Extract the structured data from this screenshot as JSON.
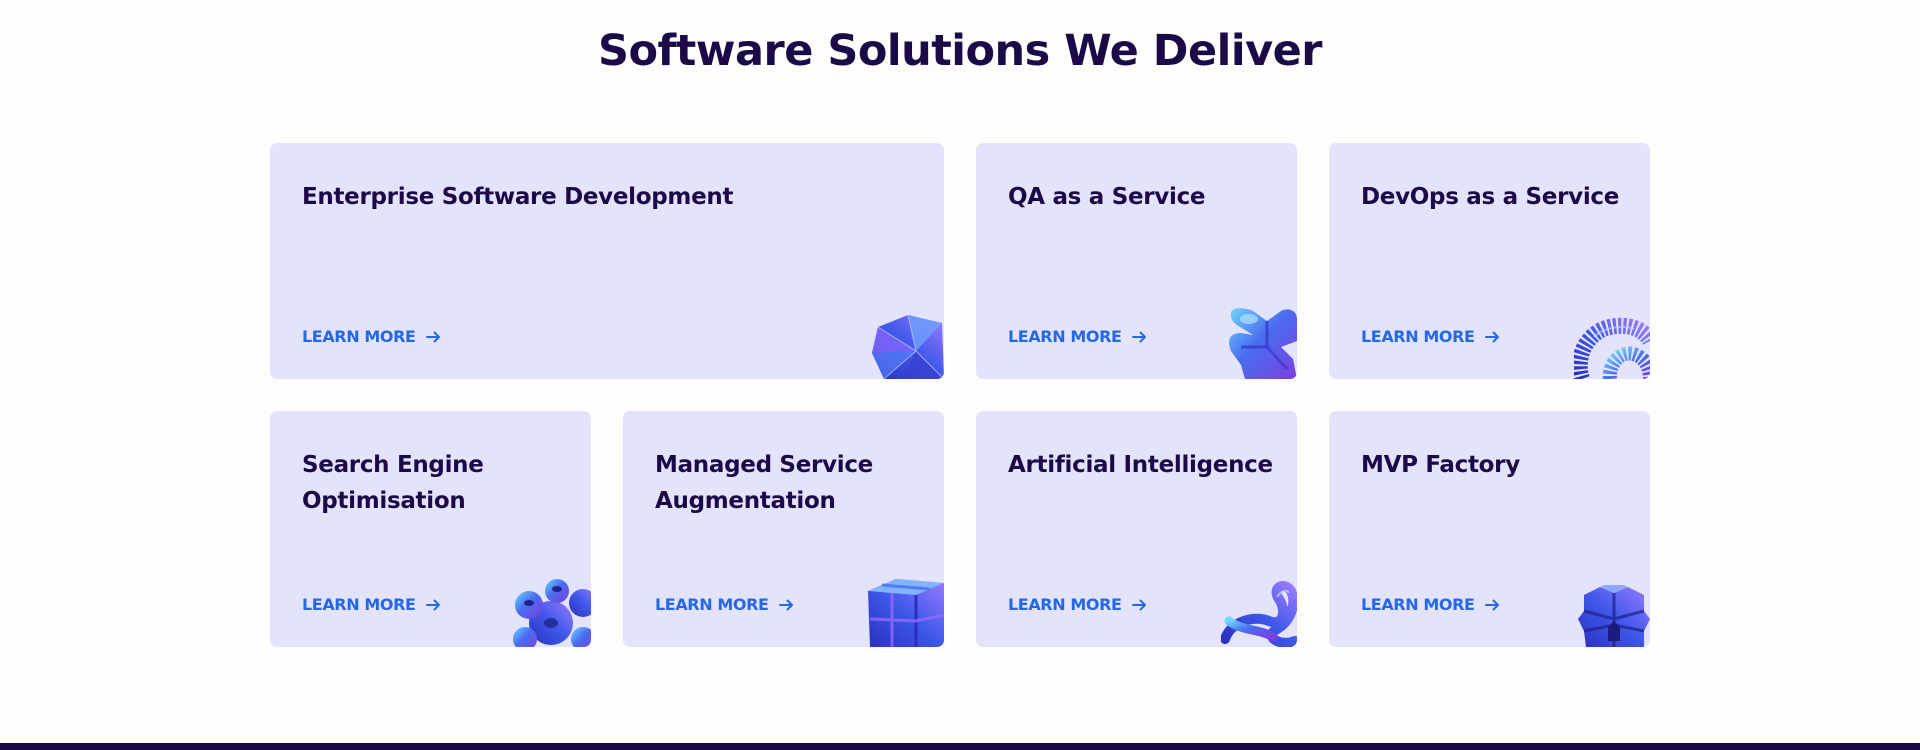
{
  "section": {
    "title": "Software Solutions We Deliver"
  },
  "cards": [
    {
      "title": "Enterprise Software Development",
      "link": "LEARN MORE",
      "icon": "crystal-star-3d-icon"
    },
    {
      "title": "QA as a Service",
      "link": "LEARN MORE",
      "icon": "puffy-cross-3d-icon"
    },
    {
      "title": "DevOps as a Service",
      "link": "LEARN MORE",
      "icon": "coil-ring-3d-icon"
    },
    {
      "title": "Search Engine Optimisation",
      "link": "LEARN MORE",
      "icon": "sphere-cluster-3d-icon"
    },
    {
      "title": "Managed Service Augmentation",
      "link": "LEARN MORE",
      "icon": "cube-grid-3d-icon"
    },
    {
      "title": "Artificial Intelligence",
      "link": "LEARN MORE",
      "icon": "twisted-knot-3d-icon"
    },
    {
      "title": "MVP Factory",
      "link": "LEARN MORE",
      "icon": "stacked-blocks-3d-icon"
    }
  ],
  "colors": {
    "background": "#fffdfb",
    "card": "#e3e3fc",
    "heading": "#1c0a48",
    "link": "#2568e5",
    "footer": "#1c0a48"
  }
}
